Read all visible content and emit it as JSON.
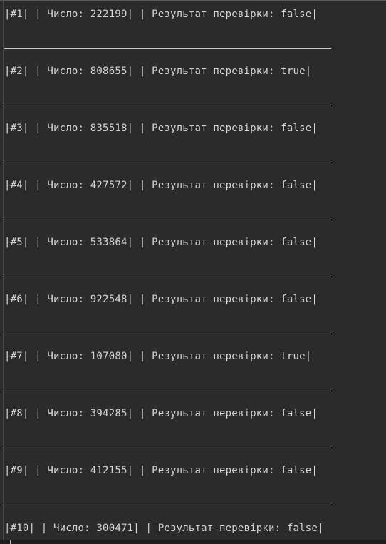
{
  "console": {
    "lines": [
      "|#1| | Число: 222199| | Результат перевірки: false|",
      "|#2| | Число: 808655| | Результат перевірки: true|",
      "|#3| | Число: 835518| | Результат перевірки: false|",
      "|#4| | Число: 427572| | Результат перевірки: false|",
      "|#5| | Число: 533864| | Результат перевірки: false|",
      "|#6| | Число: 922548| | Результат перевірки: false|",
      "|#7| | Число: 107080| | Результат перевірки: true|",
      "|#8| | Число: 394285| | Результат перевірки: false|",
      "|#9| | Число: 412155| | Результат перевірки: false|",
      "|#10| | Число: 300471| | Результат перевірки: false|"
    ]
  },
  "colors": {
    "background": "#2b2b2b",
    "text": "#d6d6d6",
    "separator": "#cfcfcf"
  }
}
